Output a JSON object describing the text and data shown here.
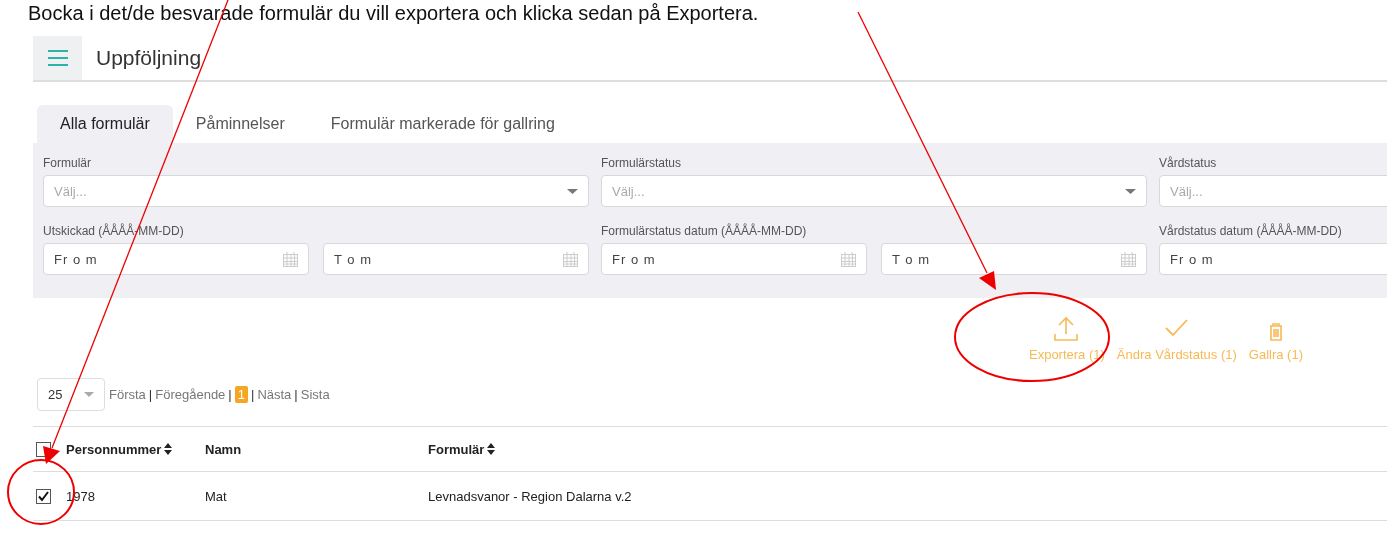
{
  "instruction": "Bocka i det/de besvarade formulär du vill exportera och klicka sedan på Exportera.",
  "header": {
    "title": "Uppföljning"
  },
  "tabs": [
    {
      "label": "Alla formulär",
      "selected": true
    },
    {
      "label": "Påminnelser",
      "selected": false
    },
    {
      "label": "Formulär markerade för gallring",
      "selected": false
    }
  ],
  "filters": [
    {
      "kind": "select",
      "label": "Formulär",
      "placeholder": "Välj..."
    },
    {
      "kind": "select",
      "label": "Formulärstatus",
      "placeholder": "Välj..."
    },
    {
      "kind": "select",
      "label": "Vårdstatus",
      "placeholder": "Välj..."
    },
    {
      "kind": "daterange",
      "label": "Utskickad (ÅÅÅÅ-MM-DD)",
      "from": "Fr o m",
      "to": "T o m"
    },
    {
      "kind": "daterange",
      "label": "Formulärstatus datum (ÅÅÅÅ-MM-DD)",
      "from": "Fr o m",
      "to": "T o m"
    },
    {
      "kind": "daterange",
      "label": "Vårdstatus datum (ÅÅÅÅ-MM-DD)",
      "from": "Fr o m"
    }
  ],
  "actions": [
    {
      "kind": "export",
      "label": "Exportera (1)"
    },
    {
      "kind": "check",
      "label": "Ändra Vårdstatus (1)"
    },
    {
      "kind": "delete",
      "label": "Gallra (1)"
    }
  ],
  "pager": {
    "page_size": "25",
    "separator": "|",
    "links": [
      {
        "label": "Första",
        "kind": "link"
      },
      {
        "label": "Föregående",
        "kind": "link"
      },
      {
        "label": "1",
        "kind": "page",
        "selected": true
      },
      {
        "label": "Nästa",
        "kind": "link"
      },
      {
        "label": "Sista",
        "kind": "link"
      }
    ]
  },
  "table": {
    "select_all": {
      "checked": false
    },
    "columns": [
      {
        "label": "Personnummer",
        "sortable": true
      },
      {
        "label": "Namn",
        "sortable": false
      },
      {
        "label": "Formulär",
        "sortable": true
      }
    ],
    "rows": [
      {
        "checked": true,
        "cells": [
          "1978",
          "Mat",
          "Levnadsvanor - Region Dalarna v.2"
        ]
      }
    ]
  }
}
